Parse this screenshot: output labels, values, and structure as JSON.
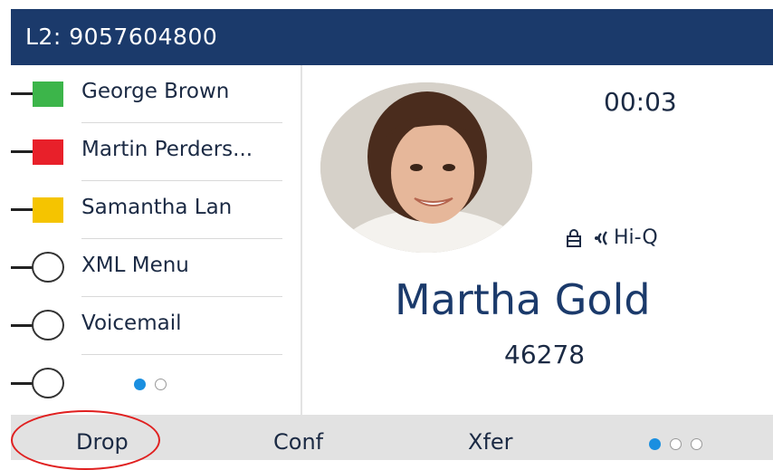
{
  "header": {
    "line_title": "L2: 9057604800"
  },
  "lines": [
    {
      "label": "George Brown",
      "kind": "square",
      "color": "#3cb54a"
    },
    {
      "label": "Martin Perders...",
      "kind": "square",
      "color": "#e8202a"
    },
    {
      "label": "Samantha Lan",
      "kind": "square",
      "color": "#f5c400"
    },
    {
      "label": "XML Menu",
      "kind": "circle"
    },
    {
      "label": "Voicemail",
      "kind": "circle"
    }
  ],
  "call": {
    "timer": "00:03",
    "hiq_label": "Hi-Q",
    "caller_name": "Martha Gold",
    "caller_number": "46278"
  },
  "softkeys": {
    "drop": "Drop",
    "conf": "Conf",
    "xfer": "Xfer"
  },
  "colors": {
    "header_bg": "#1b3a6b",
    "accent_dot": "#1a8fe0",
    "highlight_ring": "#e02020"
  }
}
